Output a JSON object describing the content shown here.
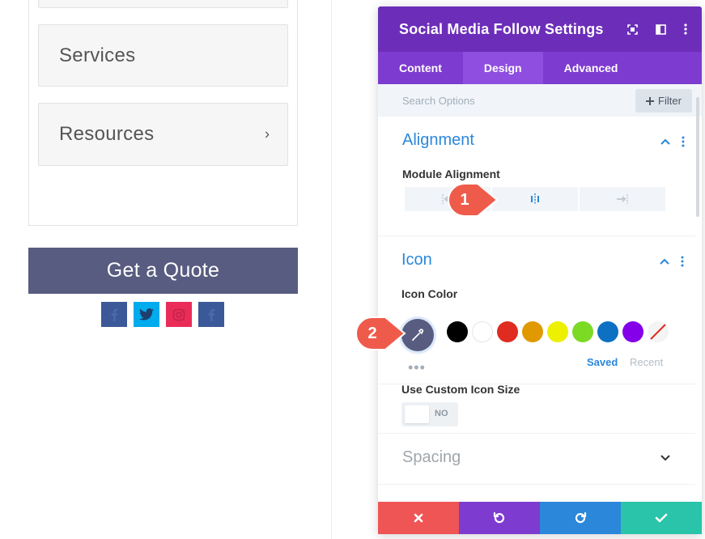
{
  "left_page": {
    "nav_items": [
      {
        "label": "Services",
        "has_chevron": false
      },
      {
        "label": "Resources",
        "has_chevron": true
      }
    ],
    "chevron": "›",
    "quote_button": "Get a Quote",
    "social_icons": [
      {
        "name": "facebook-icon",
        "color": "#3b5998"
      },
      {
        "name": "twitter-icon",
        "color": "#00aced"
      },
      {
        "name": "instagram-icon",
        "color": "#ea2c59"
      },
      {
        "name": "facebook-icon",
        "color": "#3b5998"
      }
    ]
  },
  "modal": {
    "title": "Social Media Follow Settings",
    "header_icons": [
      "fullscreen-icon",
      "split-view-icon",
      "more-icon"
    ],
    "tabs": [
      {
        "label": "Content",
        "active": false
      },
      {
        "label": "Design",
        "active": true
      },
      {
        "label": "Advanced",
        "active": false
      }
    ],
    "search_placeholder": "Search Options",
    "filter_label": "Filter",
    "sections": {
      "alignment": {
        "title": "Alignment",
        "module_alignment_label": "Module Alignment",
        "options": [
          "align-left-icon",
          "align-center-icon",
          "align-right-icon"
        ],
        "selected": "center"
      },
      "icon": {
        "title": "Icon",
        "icon_color_label": "Icon Color",
        "current_color": "#585c80",
        "swatches": [
          "#000000",
          "#ffffff",
          "#e02b20",
          "#e09900",
          "#edf000",
          "#7cda24",
          "#0c71c3",
          "#8300e9",
          "transparent"
        ],
        "saved_label": "Saved",
        "recent_label": "Recent",
        "more_dots": "•••",
        "custom_size_label": "Use Custom Icon Size",
        "toggle_value": "NO"
      },
      "spacing": {
        "title": "Spacing"
      }
    },
    "footer_buttons": [
      {
        "name": "cancel-button",
        "color": "#ef5555"
      },
      {
        "name": "undo-button",
        "color": "#7e3bd0"
      },
      {
        "name": "redo-button",
        "color": "#2b87da"
      },
      {
        "name": "save-button",
        "color": "#29c4a9"
      }
    ]
  },
  "callouts": [
    {
      "number": "1",
      "color": "#ef5b4b"
    },
    {
      "number": "2",
      "color": "#ef5b4b"
    }
  ],
  "colors": {
    "header_purple": "#6c2eb9",
    "tab_purple": "#7e3bd0",
    "accent_blue": "#2b87da",
    "quote_button": "#585c80"
  }
}
